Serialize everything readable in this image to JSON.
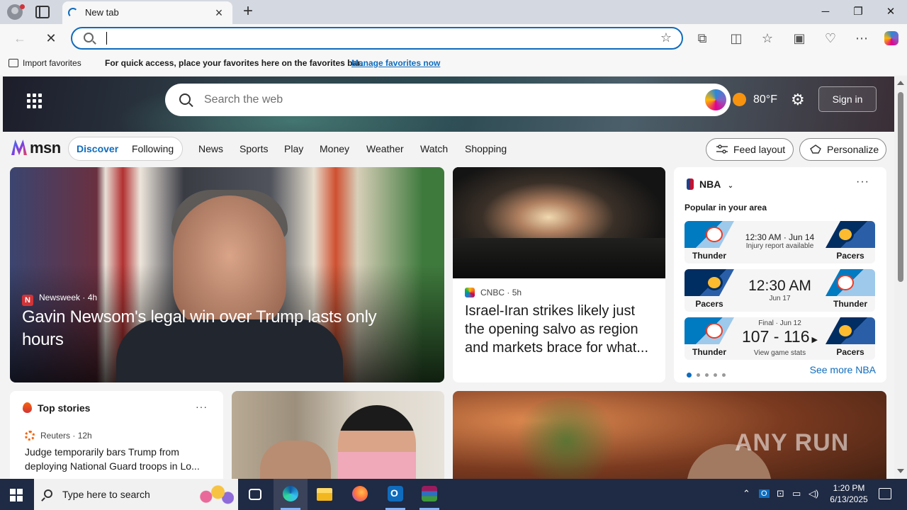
{
  "browser": {
    "tab_title": "New tab",
    "address_value": "",
    "window_controls": [
      "minimize",
      "restore",
      "close"
    ]
  },
  "favorites_bar": {
    "import_label": "Import favorites",
    "message": "For quick access, place your favorites here on the favorites bar.",
    "manage_link": "Manage favorites now"
  },
  "header": {
    "search_placeholder": "Search the web",
    "temperature": "80°F",
    "sign_in": "Sign in"
  },
  "nav": {
    "logo": "msn",
    "segments": [
      "Discover",
      "Following"
    ],
    "links": [
      "News",
      "Sports",
      "Play",
      "Money",
      "Weather",
      "Watch",
      "Shopping"
    ],
    "feed_layout": "Feed layout",
    "personalize": "Personalize"
  },
  "hero_story": {
    "source": "Newsweek",
    "age": "4h",
    "title": "Gavin Newsom's legal win over Trump lasts only hours"
  },
  "side_story": {
    "source": "CNBC",
    "age": "5h",
    "title": "Israel-Iran strikes likely just the opening salvo as region and markets brace for what..."
  },
  "nba": {
    "title": "NBA",
    "subtitle": "Popular in your area",
    "games": [
      {
        "left": "Thunder",
        "right": "Pacers",
        "main": "12:30 AM · Jun 14",
        "sub": "Injury report available"
      },
      {
        "left": "Pacers",
        "right": "Thunder",
        "main": "12:30 AM",
        "sub": "Jun 17"
      },
      {
        "left": "Thunder",
        "right": "Pacers",
        "status": "Final · Jun 12",
        "score": "107 - 116",
        "sub": "View game stats"
      }
    ],
    "see_more": "See more NBA"
  },
  "top_stories": {
    "title": "Top stories",
    "source": "Reuters",
    "age": "12h",
    "headline": "Judge temporarily bars Trump from deploying National Guard troops in Lo..."
  },
  "watermark": "ANY RUN",
  "taskbar": {
    "search_placeholder": "Type here to search",
    "time": "1:20 PM",
    "date": "6/13/2025"
  },
  "colors": {
    "accent": "#0f6cbd",
    "taskbar": "#1f2a44",
    "weather_sun": "#f7930e"
  }
}
